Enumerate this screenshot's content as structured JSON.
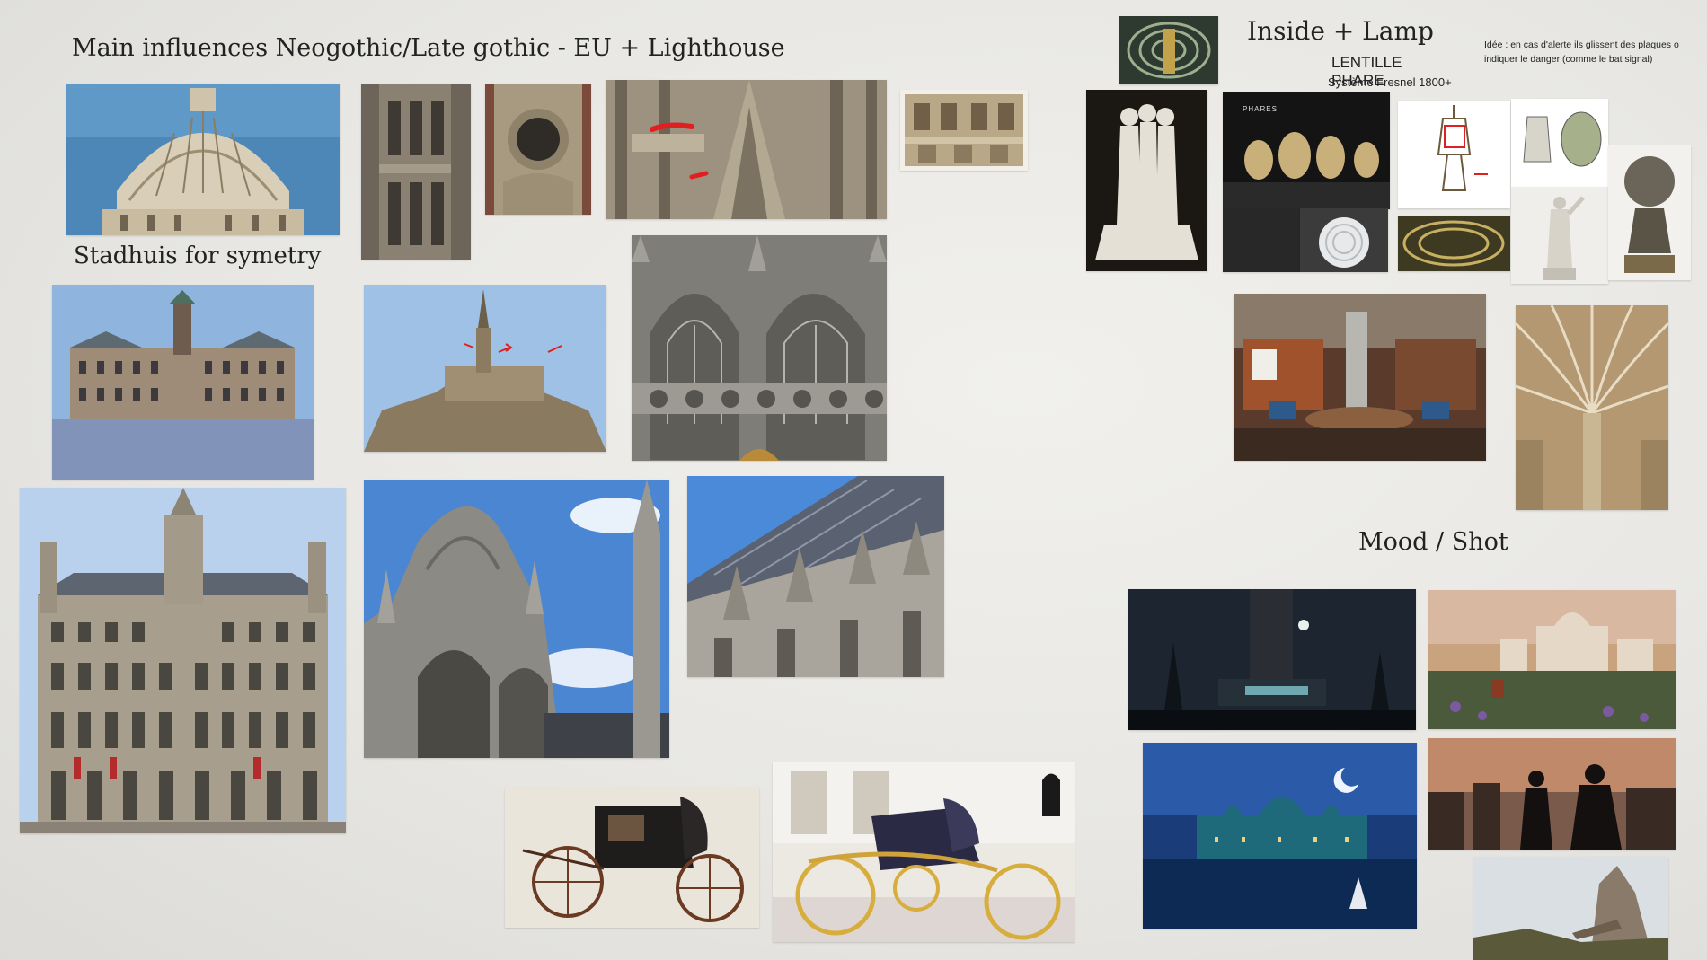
{
  "board": {
    "title_main": "Main influences Neogothic/Late gothic - EU + Lighthouse",
    "title_stadhuis": "Stadhuis for symetry",
    "title_inside": "Inside + Lamp",
    "lens_title": "LENTILLE PHARE",
    "lens_subtitle": "Système Fresnel 1800+",
    "note": "Idée : en cas d'alerte ils glissent des plaques o indiquer le danger (comme le bat signal)",
    "note_line1": "Idée : en cas d'alerte ils glissent des plaques o",
    "note_line2": "indiquer le danger (comme le bat signal)",
    "title_mood": "Mood / Shot",
    "phares_label": "PHARES"
  }
}
